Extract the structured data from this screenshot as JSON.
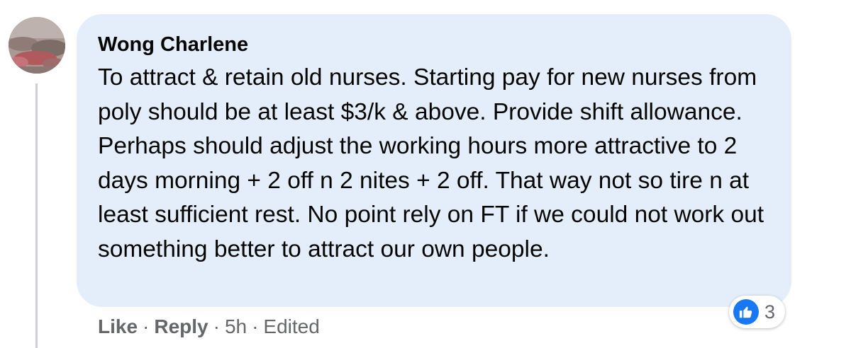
{
  "comment": {
    "author": "Wong Charlene",
    "text": "To attract & retain old nurses. Starting pay for new nurses from poly should be at least $3/k & above. Provide shift allowance. Perhaps should adjust the working hours more attractive to 2 days morning + 2 off n 2 nites + 2 off. That way not so tire n at least sufficient rest. No point rely on FT if we could not work out something better to attract our own people.",
    "reaction_count": "3",
    "reaction_icon": "thumbs-up-icon"
  },
  "actions": {
    "like_label": "Like",
    "reply_label": "Reply",
    "separator": "·",
    "timestamp": "5h",
    "edited_label": "Edited"
  },
  "colors": {
    "bubble_background": "#e4eefa",
    "like_blue": "#1877f2",
    "secondary_text": "#65676b"
  }
}
